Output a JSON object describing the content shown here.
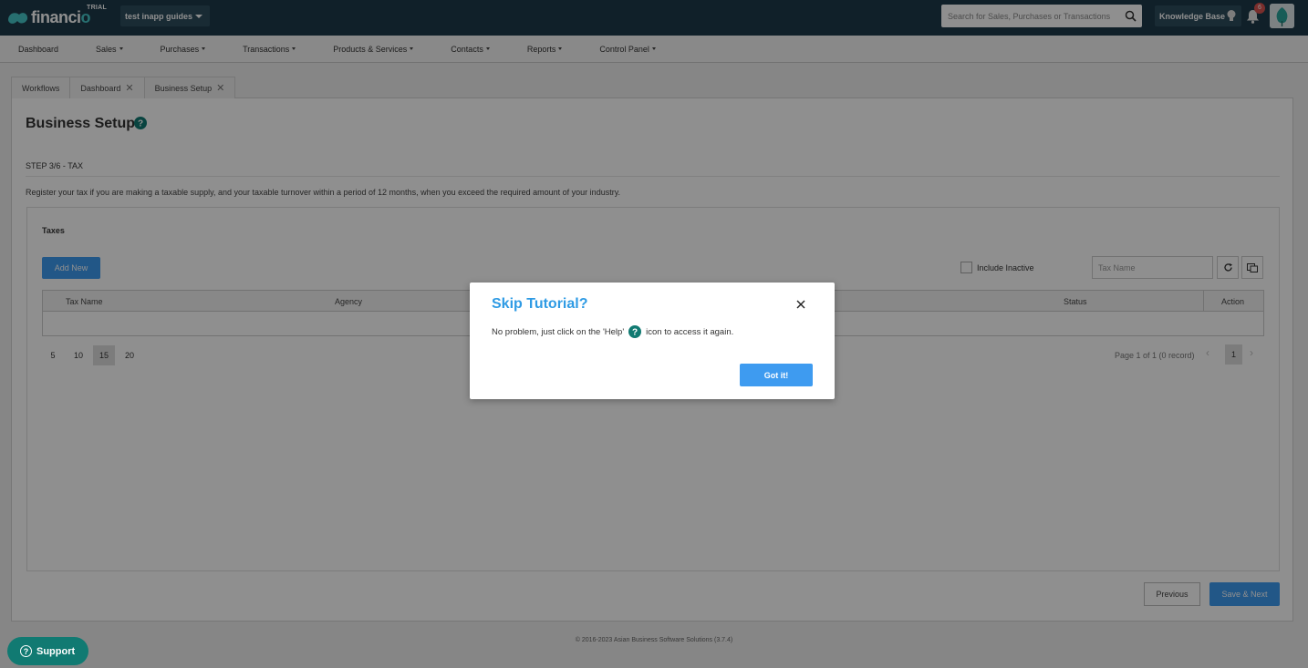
{
  "topbar": {
    "logo_text": "financio",
    "trial_label": "TRIAL",
    "company": "test inapp guides",
    "search_placeholder": "Search for Sales, Purchases or Transactions",
    "knowledge_base": "Knowledge Base",
    "notification_count": "6"
  },
  "nav": {
    "items": [
      "Dashboard",
      "Sales",
      "Purchases",
      "Transactions",
      "Products & Services",
      "Contacts",
      "Reports",
      "Control Panel"
    ]
  },
  "tabs": [
    "Workflows",
    "Dashboard",
    "Business Setup"
  ],
  "page": {
    "title": "Business Setup",
    "step": "STEP 3/6 - TAX",
    "description": "Register your tax if you are making a taxable supply, and your taxable turnover within a period of 12 months, when you exceed the required amount of your industry.",
    "section_title": "Taxes",
    "add_new": "Add New",
    "include_inactive": "Include Inactive",
    "tax_name_placeholder": "Tax Name",
    "columns": [
      "Tax Name",
      "Agency",
      "Status",
      "Action"
    ],
    "page_sizes": [
      "5",
      "10",
      "15",
      "20"
    ],
    "active_page_size": "15",
    "page_info": "Page 1 of 1 (0 record)",
    "current_page": "1",
    "previous": "Previous",
    "save_next": "Save & Next"
  },
  "footer": "© 2016-2023 Asian Business Software Solutions (3.7.4)",
  "support": "Support",
  "modal": {
    "title": "Skip Tutorial?",
    "text_before": "No problem, just click on the 'Help'",
    "text_after": "icon to access it again.",
    "button": "Got it!"
  },
  "colors": {
    "topbar": "#1e3a4a",
    "accent": "#3e9bf0",
    "help_icon": "#117a72",
    "modal_title": "#2f9be4"
  }
}
